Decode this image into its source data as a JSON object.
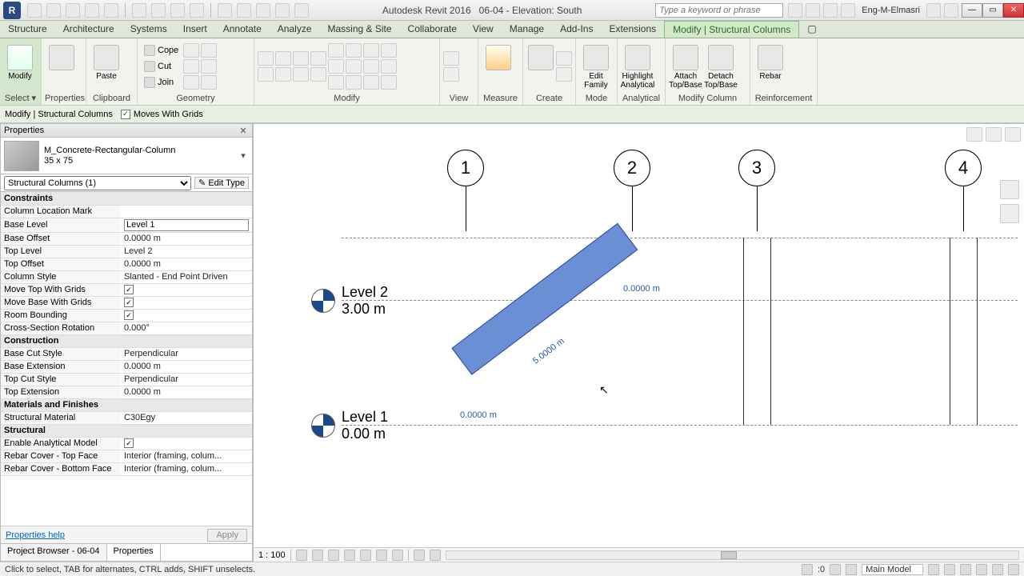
{
  "title": {
    "app": "Autodesk Revit 2016",
    "doc": "06-04 - Elevation: South",
    "search_ph": "Type a keyword or phrase",
    "user": "Eng-M-Elmasri"
  },
  "tabs": {
    "items": [
      "Structure",
      "Architecture",
      "Systems",
      "Insert",
      "Annotate",
      "Analyze",
      "Massing & Site",
      "Collaborate",
      "View",
      "Manage",
      "Add-Ins",
      "Extensions"
    ],
    "context": "Modify | Structural Columns"
  },
  "ribbon": {
    "select": "Select ▾",
    "properties": "Properties",
    "clipboard": "Clipboard",
    "paste": "Paste",
    "cope": "Cope",
    "cut": "Cut",
    "join": "Join",
    "geometry": "Geometry",
    "modify": "Modify",
    "view": "View",
    "measure": "Measure",
    "create": "Create",
    "edit_family": "Edit Family",
    "mode": "Mode",
    "highlight": "Highlight Analytical",
    "analytical": "Analytical",
    "attach": "Attach Top/Base",
    "detach": "Detach Top/Base",
    "modify_column": "Modify Column",
    "rebar": "Rebar",
    "reinforcement": "Reinforcement",
    "modify_btn": "Modify"
  },
  "optbar": {
    "panel": "Modify | Structural Columns",
    "moves": "Moves With Grids"
  },
  "props": {
    "header": "Properties",
    "family": "M_Concrete-Rectangular-Column",
    "type": "35 x 75",
    "category": "Structural Columns (1)",
    "edit_type": "Edit Type",
    "sections": {
      "constraints": "Constraints",
      "construction": "Construction",
      "materials": "Materials and Finishes",
      "structural": "Structural"
    },
    "rows": {
      "col_loc_mark": {
        "l": "Column Location Mark",
        "v": ""
      },
      "base_level": {
        "l": "Base Level",
        "v": "Level 1"
      },
      "base_offset": {
        "l": "Base Offset",
        "v": "0.0000 m"
      },
      "top_level": {
        "l": "Top Level",
        "v": "Level 2"
      },
      "top_offset": {
        "l": "Top Offset",
        "v": "0.0000 m"
      },
      "column_style": {
        "l": "Column Style",
        "v": "Slanted - End Point Driven"
      },
      "move_top": {
        "l": "Move Top With Grids",
        "v": true
      },
      "move_base": {
        "l": "Move Base With Grids",
        "v": true
      },
      "room_bound": {
        "l": "Room Bounding",
        "v": true
      },
      "cross_rot": {
        "l": "Cross-Section Rotation",
        "v": "0.000°"
      },
      "base_cut": {
        "l": "Base Cut Style",
        "v": "Perpendicular"
      },
      "base_ext": {
        "l": "Base Extension",
        "v": "0.0000 m"
      },
      "top_cut": {
        "l": "Top Cut Style",
        "v": "Perpendicular"
      },
      "top_ext": {
        "l": "Top Extension",
        "v": "0.0000 m"
      },
      "material": {
        "l": "Structural Material",
        "v": "C30Egy"
      },
      "enable_am": {
        "l": "Enable Analytical Model",
        "v": true
      },
      "rebar_top": {
        "l": "Rebar Cover - Top Face",
        "v": "Interior (framing, colum..."
      },
      "rebar_bot": {
        "l": "Rebar Cover - Bottom Face",
        "v": "Interior (framing, colum..."
      }
    },
    "help": "Properties help",
    "apply": "Apply"
  },
  "tabs_bottom": {
    "pb": "Project Browser - 06-04",
    "pr": "Properties"
  },
  "canvas": {
    "grids": [
      "1",
      "2",
      "3",
      "4"
    ],
    "levels": [
      {
        "name": "Level 2",
        "elev": "3.00 m"
      },
      {
        "name": "Level 1",
        "elev": "0.00 m"
      }
    ],
    "dims": {
      "top": "0.0000 m",
      "mid": "5.0000 m",
      "bot": "0.0000 m"
    }
  },
  "vcb": {
    "scale": "1 : 100"
  },
  "status": {
    "hint": "Click to select, TAB for alternates, CTRL adds, SHIFT unselects.",
    "zero": ":0",
    "workset": "Main Model"
  }
}
